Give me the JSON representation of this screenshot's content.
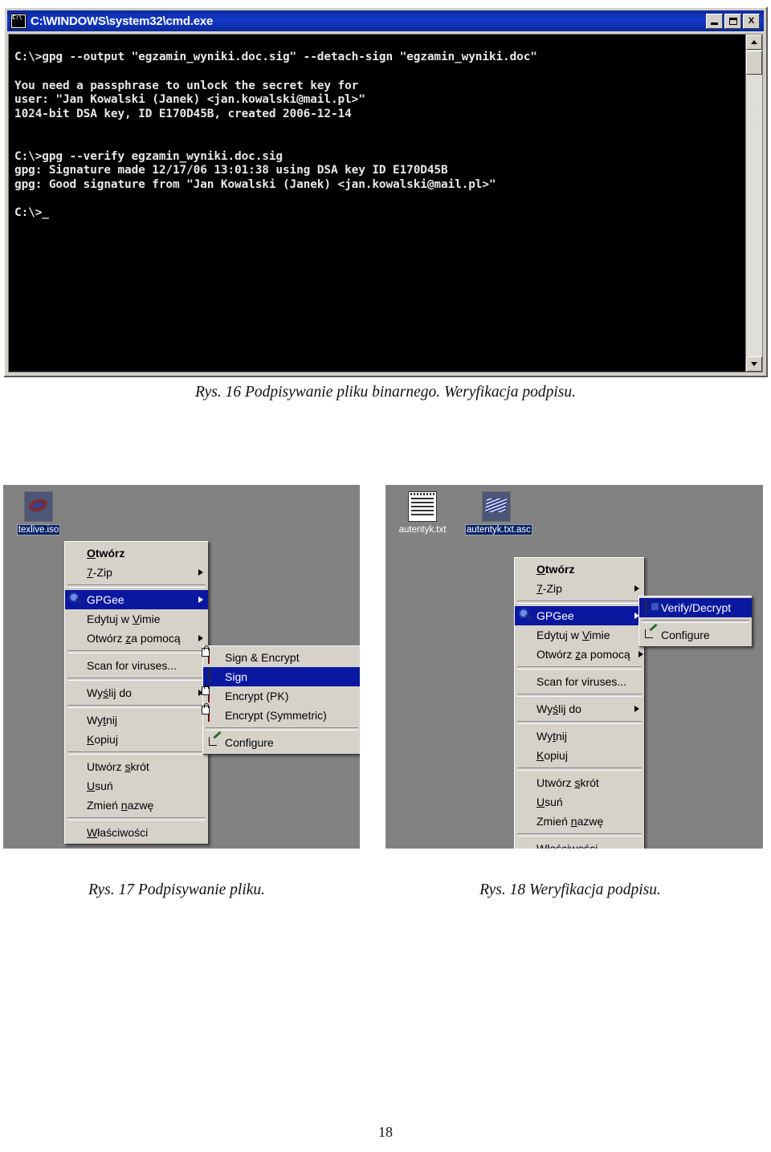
{
  "console": {
    "title": "C:\\WINDOWS\\system32\\cmd.exe",
    "icon": "cmd-icon",
    "caption_buttons": [
      {
        "name": "minimize",
        "glyph": ""
      },
      {
        "name": "maximize",
        "glyph": ""
      },
      {
        "name": "close",
        "glyph": "X"
      }
    ],
    "text": "C:\\>gpg --output \"egzamin_wyniki.doc.sig\" --detach-sign \"egzamin_wyniki.doc\"\n\nYou need a passphrase to unlock the secret key for\nuser: \"Jan Kowalski (Janek) <jan.kowalski@mail.pl>\"\n1024-bit DSA key, ID E170D45B, created 2006-12-14\n\n\nC:\\>gpg --verify egzamin_wyniki.doc.sig\ngpg: Signature made 12/17/06 13:01:38 using DSA key ID E170D45B\ngpg: Good signature from \"Jan Kowalski (Janek) <jan.kowalski@mail.pl>\"\n\nC:\\>_"
  },
  "captions": {
    "fig16": "Rys. 16  Podpisywanie pliku binarnego. Weryfikacja podpisu.",
    "fig17": "Rys. 17  Podpisywanie pliku.",
    "fig18": "Rys. 18  Weryfikacja podpisu."
  },
  "page_number": "18",
  "left_shot": {
    "desktop_icons": [
      {
        "label": "texlive.iso",
        "icon": "iso-disc-icon",
        "selected": true
      }
    ],
    "context_menu": [
      {
        "label": "Otwórz",
        "bold": true,
        "accel": "O"
      },
      {
        "label": "7-Zip",
        "submenu": true,
        "accel": "7"
      },
      {
        "separator": true
      },
      {
        "label": "GPGee",
        "icon": "gpgee-icon",
        "submenu": true,
        "highlighted": true
      },
      {
        "label": "Edytuj w Vimie",
        "accel": "V"
      },
      {
        "label": "Otwórz za pomocą",
        "submenu": true,
        "accel": "z"
      },
      {
        "separator": true
      },
      {
        "label": "Scan for viruses...",
        "icon": "shield-icon"
      },
      {
        "separator": true
      },
      {
        "label": "Wyślij do",
        "submenu": true,
        "accel": "ś"
      },
      {
        "separator": true
      },
      {
        "label": "Wytnij",
        "accel": "t"
      },
      {
        "label": "Kopiuj",
        "accel": "K"
      },
      {
        "separator": true
      },
      {
        "label": "Utwórz skrót",
        "accel": "s"
      },
      {
        "label": "Usuń",
        "accel": "U"
      },
      {
        "label": "Zmień nazwę",
        "accel": "n"
      },
      {
        "separator": true
      },
      {
        "label": "Właściwości",
        "accel": "W"
      }
    ],
    "submenu": [
      {
        "label": "Sign & Encrypt",
        "icon": "envelope-sign-encrypt-icon"
      },
      {
        "label": "Sign",
        "icon": "document-sign-icon",
        "highlighted": true
      },
      {
        "label": "Encrypt (PK)",
        "icon": "envelope-lock-icon"
      },
      {
        "label": "Encrypt (Symmetric)",
        "icon": "envelope-lock-icon"
      },
      {
        "separator": true
      },
      {
        "label": "Configure",
        "icon": "pen-configure-icon"
      }
    ]
  },
  "right_shot": {
    "desktop_icons": [
      {
        "label": "autentyk.txt",
        "icon": "notepad-icon",
        "selected": false
      },
      {
        "label": "autentyk.txt.asc",
        "icon": "signed-file-icon",
        "selected": true
      }
    ],
    "context_menu": [
      {
        "label": "Otwórz",
        "bold": true,
        "accel": "O"
      },
      {
        "label": "7-Zip",
        "submenu": true,
        "accel": "7"
      },
      {
        "separator": true
      },
      {
        "label": "GPGee",
        "icon": "gpgee-icon",
        "submenu": true,
        "highlighted": true
      },
      {
        "label": "Edytuj w Vimie",
        "accel": "V"
      },
      {
        "label": "Otwórz za pomocą",
        "submenu": true,
        "accel": "z"
      },
      {
        "separator": true
      },
      {
        "label": "Scan for viruses...",
        "icon": "shield-icon"
      },
      {
        "separator": true
      },
      {
        "label": "Wyślij do",
        "submenu": true,
        "accel": "ś"
      },
      {
        "separator": true
      },
      {
        "label": "Wytnij",
        "accel": "t"
      },
      {
        "label": "Kopiuj",
        "accel": "K"
      },
      {
        "separator": true
      },
      {
        "label": "Utwórz skrót",
        "accel": "s"
      },
      {
        "label": "Usuń",
        "accel": "U"
      },
      {
        "label": "Zmień nazwę",
        "accel": "n"
      },
      {
        "separator": true
      },
      {
        "label": "Właściwości",
        "accel": "W"
      }
    ],
    "submenu": [
      {
        "label": "Verify/Decrypt",
        "icon": "verify-decrypt-icon",
        "highlighted": true
      },
      {
        "separator": true
      },
      {
        "label": "Configure",
        "icon": "pen-configure-icon"
      }
    ]
  },
  "colors": {
    "titlebar": "#1438c8",
    "menu_face": "#d6d2ca",
    "menu_highlight": "#0a18a0",
    "desktop": "#828282",
    "console_bg": "#000000",
    "console_fg": "#e8e8e8"
  }
}
